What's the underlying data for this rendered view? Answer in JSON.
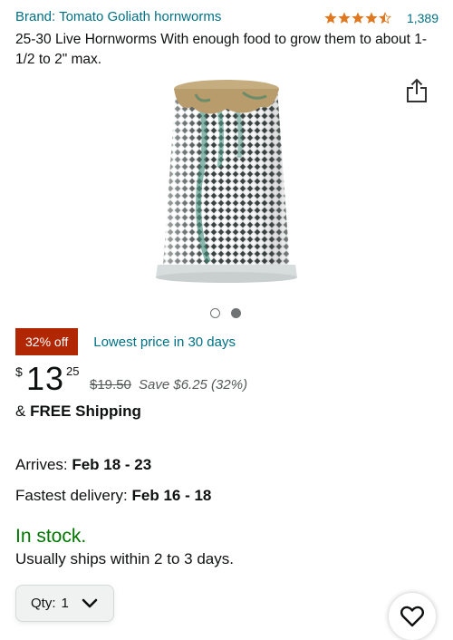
{
  "brand_line": "Brand: Tomato Goliath hornworms",
  "rating": {
    "stars": 4.5,
    "review_count": "1,389"
  },
  "title": "25-30 Live Hornworms With enough food to grow them to about 1-1/2 to 2\" max.",
  "image_carousel": {
    "total": 2,
    "active_index": 2
  },
  "deal": {
    "badge": "32% off",
    "text": "Lowest price in 30 days"
  },
  "price": {
    "currency": "$",
    "whole": "13",
    "fraction": "25",
    "list_price": "$19.50",
    "savings": "Save $6.25 (32%)"
  },
  "shipping": {
    "prefix": "& ",
    "label": "FREE Shipping"
  },
  "delivery": {
    "arrives_label": "Arrives: ",
    "arrives_date": "Feb 18 - 23",
    "fastest_label": "Fastest delivery: ",
    "fastest_date": "Feb 16 - 18"
  },
  "stock": {
    "status": "In stock.",
    "ships": "Usually ships within 2 to 3 days."
  },
  "quantity": {
    "label": "Qty:",
    "value": "1"
  },
  "icons": {
    "share": "share-icon",
    "wishlist": "heart-icon",
    "chevron": "chevron-down-icon",
    "star": "star-icon"
  },
  "colors": {
    "link": "#007185",
    "deal_badge": "#b12704",
    "in_stock": "#007600",
    "star": "#de7921"
  }
}
